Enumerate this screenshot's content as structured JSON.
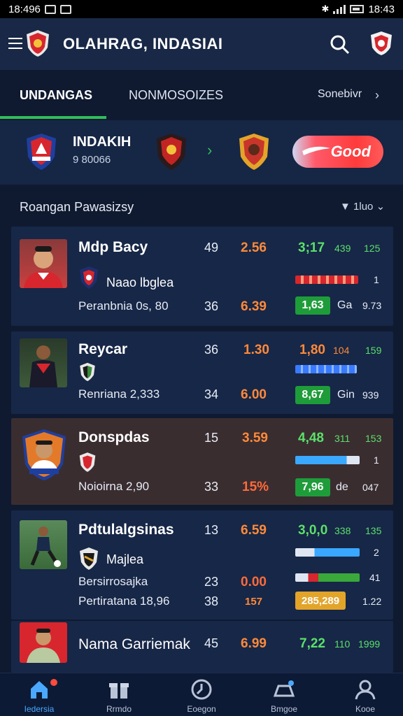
{
  "status_bar": {
    "left_time": "18:496",
    "right_time": "18:43"
  },
  "app": {
    "title": "OLAHRAG, INDASIAI"
  },
  "tabs": [
    {
      "label": "UNDANGAS",
      "active": true
    },
    {
      "label": "NONMOSOIZES"
    },
    {
      "label": "Sonebivr"
    }
  ],
  "match": {
    "team_name": "INDAKIH",
    "team_sub": "9 80066",
    "button_label": "Good",
    "button_color": "#ff3b3b"
  },
  "section": {
    "title": "Roangan Pawasizsy",
    "filter": "1luo"
  },
  "players": [
    {
      "name": "Mdp Bacy",
      "club": "Naao lbglea",
      "detail": "Peranbnia 0s, 80",
      "n1": "49",
      "n2": "36",
      "o1": "2.56",
      "o2": "6.39",
      "g1": "3;17",
      "g1b": "439",
      "g1c": "125",
      "bar_val": "1",
      "pill": "1,63",
      "pill_label": "Ga",
      "pill_val": "9.73"
    },
    {
      "name": "Reycar",
      "club": "",
      "detail": "Renriana 2,333",
      "n1": "36",
      "n2": "34",
      "o1": "1.30",
      "o2": "6.00",
      "g1": "1,80",
      "g1b": "104",
      "g1c": "159",
      "bar_val": "",
      "pill": "8,67",
      "pill_label": "Gin",
      "pill_val": "939"
    },
    {
      "name": "Donspdas",
      "club": "",
      "detail": "Noioirna 2,90",
      "n1": "15",
      "n2": "33",
      "o1": "3.59",
      "o2": "15%",
      "g1": "4,48",
      "g1b": "311",
      "g1c": "153",
      "bar_val": "1",
      "pill": "7,96",
      "pill_label": "de",
      "pill_val": "047"
    },
    {
      "name": "Pdtulalgsinas",
      "club": "Majlea",
      "detail": "Bersirrosajka",
      "detail2": "Pertiratana 18,96",
      "n1": "13",
      "n2": "23",
      "n3": "38",
      "o1": "6.59",
      "o2": "0.00",
      "o3": "157",
      "g1": "3,0,0",
      "g1b": "338",
      "g1c": "135",
      "bar_val": "2",
      "bar_val2": "41",
      "pill": "285,289",
      "pill_val": "1.22"
    },
    {
      "name": "Nama Garriemak",
      "n1": "45",
      "o1": "6.99",
      "g1": "7,22",
      "g1b": "110",
      "g1c": "1999"
    }
  ],
  "nav": [
    {
      "label": "Iedersia",
      "icon": "home-icon",
      "active": true
    },
    {
      "label": "Rrmdo",
      "icon": "gift-icon"
    },
    {
      "label": "Eoegon",
      "icon": "clock-icon"
    },
    {
      "label": "Bmgoe",
      "icon": "stadium-icon"
    },
    {
      "label": "Kooe",
      "icon": "profile-icon"
    }
  ],
  "colors": {
    "accent_green": "#2fbf5a",
    "odds_orange": "#ff8a3a",
    "value_green": "#5be06a",
    "bg": "#0f1a30"
  }
}
